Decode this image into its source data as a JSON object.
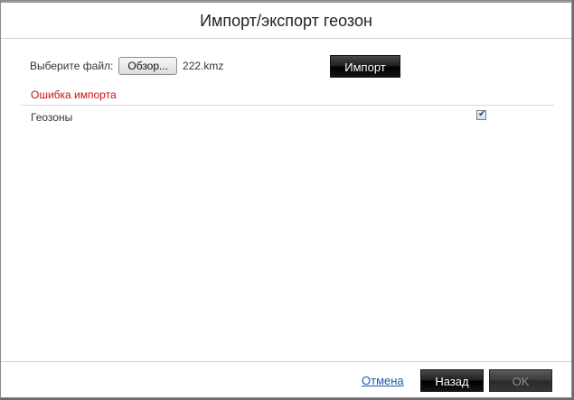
{
  "dialog": {
    "title": "Импорт/экспорт геозон"
  },
  "file": {
    "label": "Выберите файл:",
    "browse_label": "Обзор...",
    "file_name": "222.kmz",
    "import_label": "Импорт"
  },
  "status": {
    "error": "Ошибка импорта"
  },
  "options": {
    "geozones_label": "Геозоны",
    "geozones_checked": true
  },
  "footer": {
    "cancel_label": "Отмена",
    "back_label": "Назад",
    "ok_label": "OK"
  },
  "colors": {
    "error": "#cc1111",
    "link": "#1f5aa6",
    "button_dark": "#1f1f1f"
  },
  "icons": {
    "checkbox": "check-icon"
  }
}
